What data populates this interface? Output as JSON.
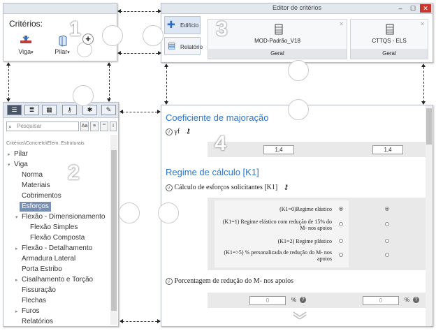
{
  "panel1": {
    "number": "1",
    "label": "Critérios:",
    "tools": [
      {
        "label": "Viga"
      },
      {
        "label": "Pilar"
      }
    ]
  },
  "panel3": {
    "number": "3",
    "window_title": "Editor de critérios",
    "side_tabs": [
      {
        "label": "Edifício"
      },
      {
        "label": "Relatório"
      }
    ],
    "cards": [
      {
        "name": "MOD-Padrão_V18",
        "group": "Geral"
      },
      {
        "name": "CTTQS - ELS",
        "group": "Geral"
      }
    ]
  },
  "panel2": {
    "number": "2",
    "search_placeholder": "Pesquisar",
    "search_buttons": [
      "Aa",
      "≡",
      "““",
      "i"
    ],
    "breadcrumb": "Critérios\\Concreto\\Elem. Estruturais",
    "tree": [
      {
        "label": "Pilar",
        "toggle": "▸",
        "level": 0
      },
      {
        "label": "Viga",
        "toggle": "▾",
        "level": 0
      },
      {
        "label": "Norma",
        "toggle": "",
        "level": 1
      },
      {
        "label": "Materiais",
        "toggle": "",
        "level": 1
      },
      {
        "label": "Cobrimentos",
        "toggle": "",
        "level": 1
      },
      {
        "label": "Esforços",
        "toggle": "",
        "level": 1,
        "selected": true
      },
      {
        "label": "Flexão - Dimensionamento",
        "toggle": "▾",
        "level": 1
      },
      {
        "label": "Flexão Simples",
        "toggle": "",
        "level": 2
      },
      {
        "label": "Flexão Composta",
        "toggle": "",
        "level": 2
      },
      {
        "label": "Flexão - Detalhamento",
        "toggle": "▸",
        "level": 1
      },
      {
        "label": "Armadura Lateral",
        "toggle": "",
        "level": 1
      },
      {
        "label": "Porta Estribo",
        "toggle": "",
        "level": 1
      },
      {
        "label": "Cisalhamento e Torção",
        "toggle": "▸",
        "level": 1
      },
      {
        "label": "Fissuração",
        "toggle": "",
        "level": 1
      },
      {
        "label": "Flechas",
        "toggle": "",
        "level": 1
      },
      {
        "label": "Furos",
        "toggle": "▸",
        "level": 1
      },
      {
        "label": "Relatórios",
        "toggle": "",
        "level": 1
      }
    ]
  },
  "panel4": {
    "number": "4",
    "section1_title": "Coeficiente de majoração",
    "gamma_label": "γf",
    "gamma_values": [
      "1,4",
      "1,4"
    ],
    "section2_title": "Regime de cálculo [K1]",
    "calc_label": "Cálculo de esforços solicitantes  [K1]",
    "options": [
      {
        "text": "(K1=0)Regime elástico",
        "col1": true,
        "col2": true
      },
      {
        "text": "(K1=1) Regime elástico com redução de 15% do M- nos apoios",
        "col1": false,
        "col2": false
      },
      {
        "text": "(K1=2) Regime plástico",
        "col1": false,
        "col2": false
      },
      {
        "text": "(K1=>5) % personalizada de redução do M- nos apoios",
        "col1": false,
        "col2": false
      }
    ],
    "reduction_label": "Porcentagem de redução do M- nos apoios",
    "reduction_values": [
      "0",
      "0"
    ],
    "percent_unit": "%"
  }
}
